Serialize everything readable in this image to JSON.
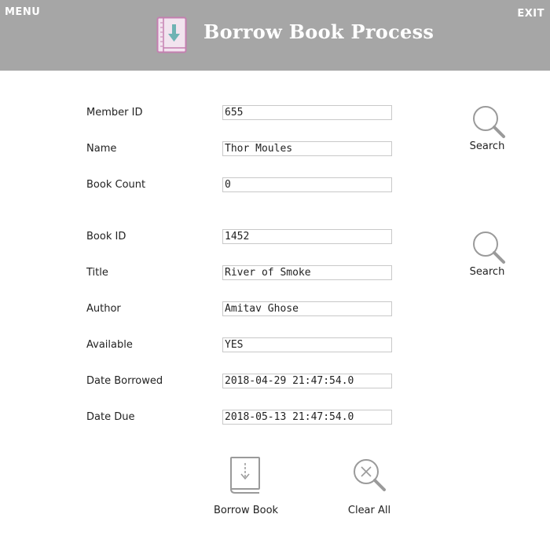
{
  "header": {
    "menu_label": "MENU",
    "exit_label": "EXIT",
    "title": "Borrow Book Process",
    "icon": "borrow-book-icon"
  },
  "member": {
    "member_id_label": "Member ID",
    "member_id_value": "655",
    "name_label": "Name",
    "name_value": "Thor Moules",
    "book_count_label": "Book Count",
    "book_count_value": "0",
    "search_label": "Search"
  },
  "book": {
    "book_id_label": "Book ID",
    "book_id_value": "1452",
    "title_label": "Title",
    "title_value": "River of Smoke",
    "author_label": "Author",
    "author_value": "Amitav Ghose",
    "available_label": "Available",
    "available_value": "YES",
    "date_borrowed_label": "Date Borrowed",
    "date_borrowed_value": "2018-04-29 21:47:54.0",
    "date_due_label": "Date Due",
    "date_due_value": "2018-05-13 21:47:54.0",
    "search_label": "Search"
  },
  "actions": {
    "borrow_label": "Borrow Book",
    "clear_label": "Clear All"
  },
  "colors": {
    "header_bg": "#a6a6a6",
    "icon_pink": "#c47fb0",
    "icon_teal": "#6fb3b4",
    "icon_gray": "#9a9a9a"
  }
}
